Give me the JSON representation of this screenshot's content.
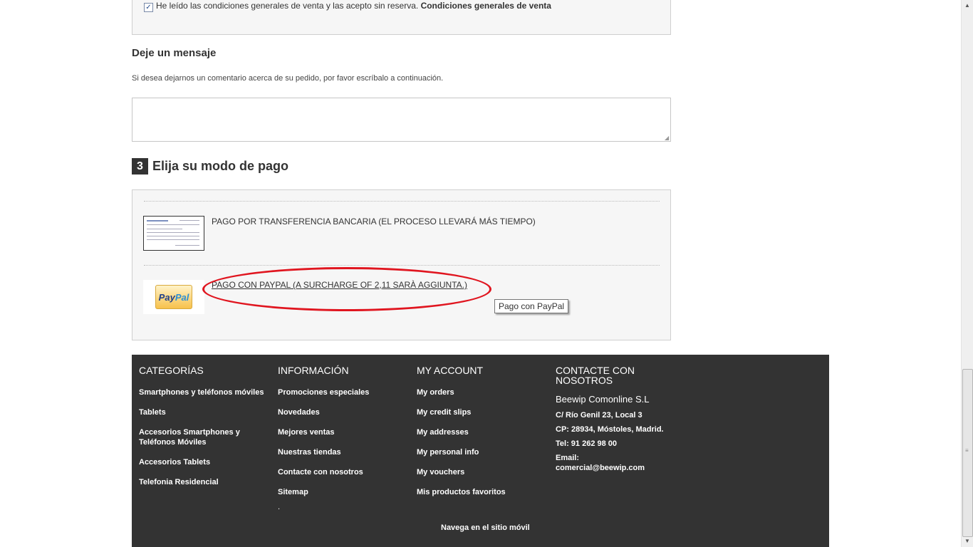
{
  "terms": {
    "checked": true,
    "text": "He leído las condiciones generales de venta y las acepto sin reserva.",
    "link": "Condiciones generales de venta"
  },
  "message": {
    "heading": "Deje un mensaje",
    "description": "Si desea dejarnos un comentario acerca de su pedido, por favor escríbalo a continuación.",
    "value": ""
  },
  "payment": {
    "step_number": "3",
    "heading": "Elija su modo de pago",
    "options": [
      {
        "label": "PAGO POR TRANSFERENCIA BANCARIA (EL PROCESO LLEVARÁ MÁS TIEMPO)",
        "icon": "bank-transfer-icon"
      },
      {
        "label": "PAGO CON PAYPAL (A SURCHARGE OF 2,11 SARÀ AGGIUNTA.)",
        "icon": "paypal-icon",
        "logo_text_a": "Pay",
        "logo_text_b": "Pal"
      }
    ],
    "tooltip": "Pago con PayPal",
    "highlight_color": "#e0151f"
  },
  "footer": {
    "background": "#333333",
    "categories": {
      "heading": "CATEGORÍAS",
      "items": [
        "Smartphones y teléfonos móviles",
        "Tablets",
        "Accesorios Smartphones y Teléfonos Móviles",
        "Accesorios Tablets",
        "Telefonia Residencial"
      ]
    },
    "information": {
      "heading": "INFORMACIÓN",
      "items": [
        "Promociones especiales",
        "Novedades",
        "Mejores ventas",
        "Nuestras tiendas",
        "Contacte con nosotros",
        "Sitemap"
      ]
    },
    "account": {
      "heading": "MY ACCOUNT",
      "items": [
        "My orders",
        "My credit slips",
        "My addresses",
        "My personal info",
        "My vouchers",
        "Mis productos favoritos"
      ]
    },
    "contact": {
      "heading": "CONTACTE CON NOSOTROS",
      "company": "Beewip Comonline S.L",
      "address": "C/ Río Genil 23, Local 3",
      "city": "CP: 28934, Móstoles, Madrid.",
      "phone": "Tel: 91 262 98 00",
      "email": "Email: comercial@beewip.com"
    },
    "dot": ".",
    "mobile_link": "Navega en el sitio móvil"
  }
}
